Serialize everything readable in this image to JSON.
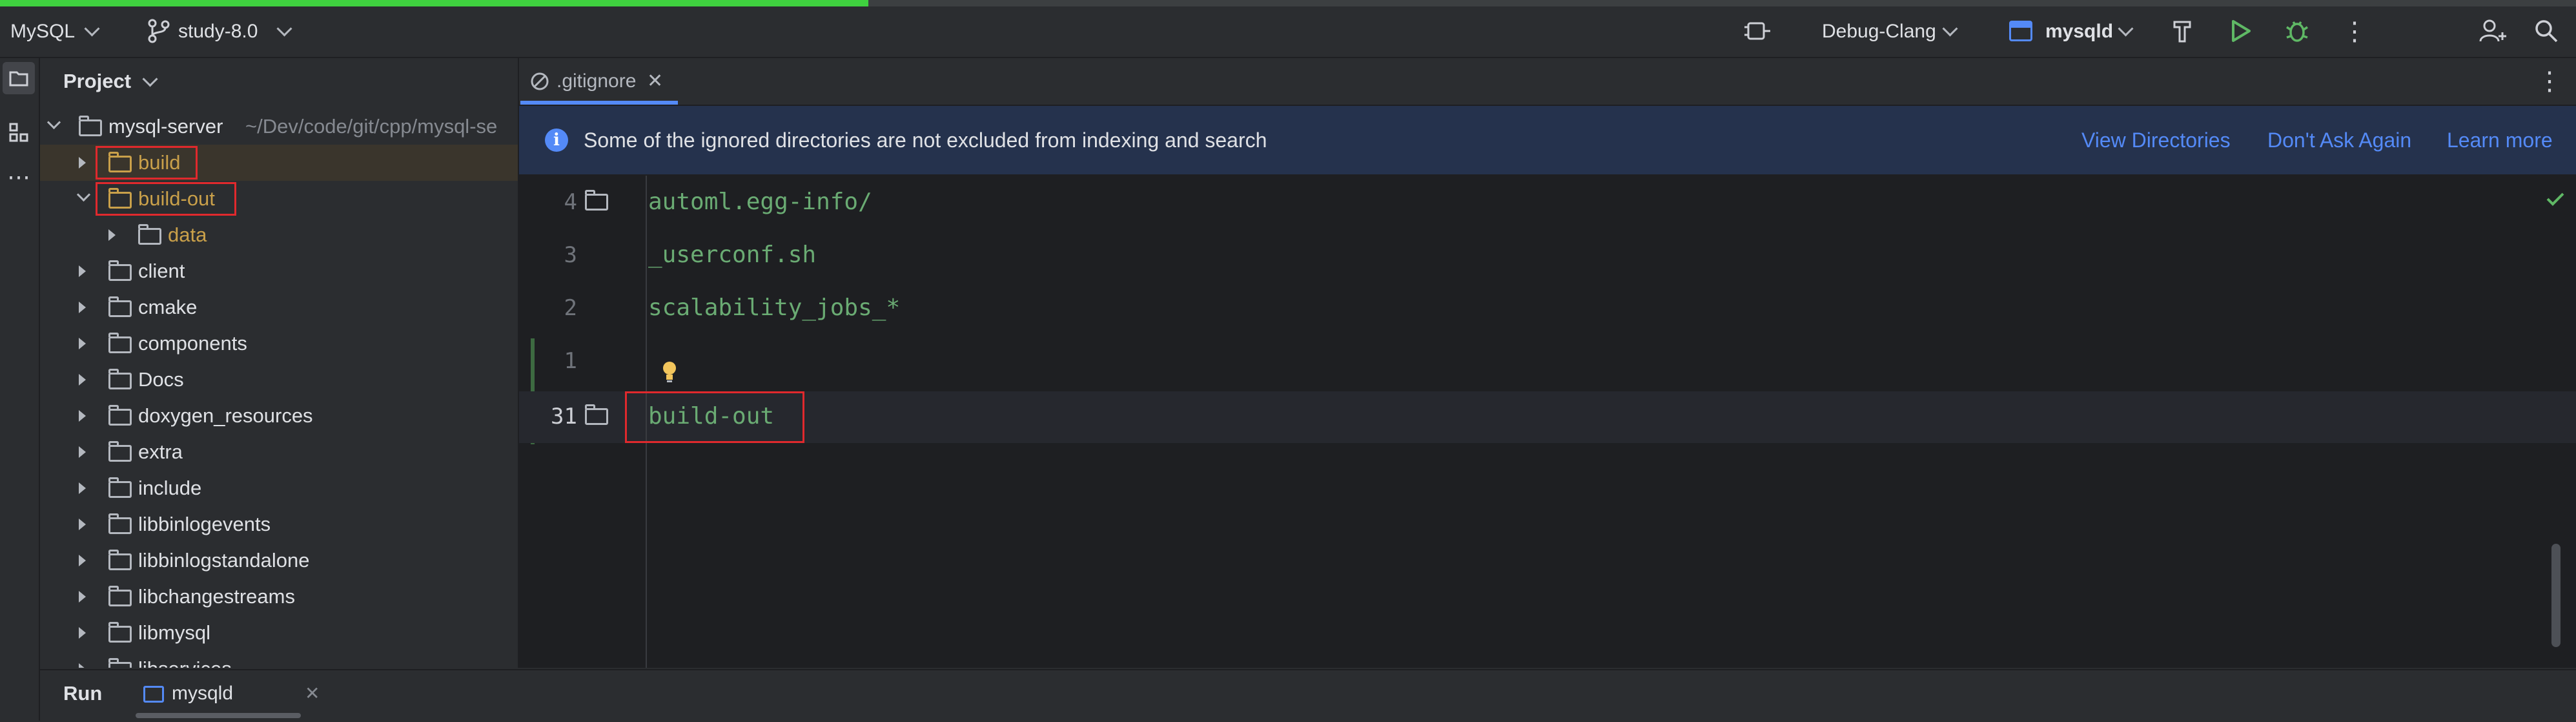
{
  "progress": {
    "fraction": 0.337,
    "color": "#3fd13f"
  },
  "titlebar": {
    "project_name": "MySQL",
    "branch": "study-8.0",
    "run_config": "Debug-Clang",
    "target": "mysqld"
  },
  "project_panel": {
    "title": "Project",
    "root": {
      "name": "mysql-server",
      "path": "~/Dev/code/git/cpp/mysql-se"
    },
    "items": [
      {
        "label": "build"
      },
      {
        "label": "build-out"
      },
      {
        "label": "data"
      },
      {
        "label": "client"
      },
      {
        "label": "cmake"
      },
      {
        "label": "components"
      },
      {
        "label": "Docs"
      },
      {
        "label": "doxygen_resources"
      },
      {
        "label": "extra"
      },
      {
        "label": "include"
      },
      {
        "label": "libbinlogevents"
      },
      {
        "label": "libbinlogstandalone"
      },
      {
        "label": "libchangestreams"
      },
      {
        "label": "libmysql"
      },
      {
        "label": "libservices"
      }
    ]
  },
  "editor": {
    "tab_label": ".gitignore",
    "banner": {
      "message": "Some of the ignored directories are not excluded from indexing and search",
      "links": [
        "View Directories",
        "Don't Ask Again",
        "Learn more"
      ]
    },
    "lines": [
      {
        "number": "4",
        "text": "automl.egg-info/"
      },
      {
        "number": "3",
        "text": "_userconf.sh"
      },
      {
        "number": "2",
        "text": "scalability_jobs_*"
      },
      {
        "number": "1",
        "text": ""
      },
      {
        "number": "31",
        "text": "build-out"
      }
    ]
  },
  "bottom": {
    "run_label": "Run",
    "run_tab": "mysqld"
  },
  "colors": {
    "accent_link": "#548af7",
    "highlight_box": "#e0292d",
    "code_green": "#6aab73",
    "ignored_yellow": "#c9a04a"
  }
}
